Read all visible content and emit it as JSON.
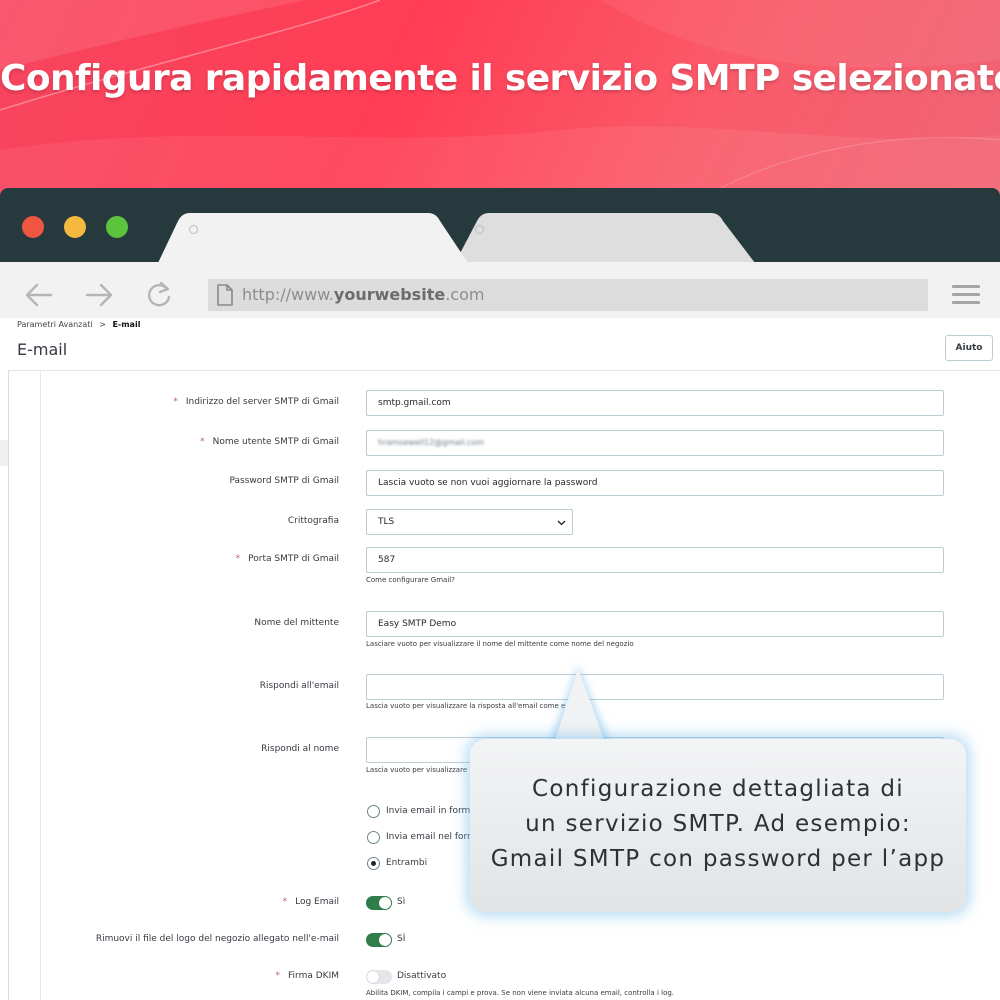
{
  "banner": {
    "title": "Configura rapidamente il servizio SMTP selezionato"
  },
  "browser": {
    "url_prefix": "http://www.",
    "url_domain": "yourwebsite",
    "url_suffix": ".com",
    "traffic_lights": [
      "#f05542",
      "#f4b93e",
      "#5bc33c"
    ],
    "icons": [
      "back-arrow-icon",
      "forward-arrow-icon",
      "reload-icon",
      "page-icon",
      "hamburger-menu-icon"
    ]
  },
  "page": {
    "breadcrumb_parent": "Parametri Avanzati",
    "breadcrumb_separator": ">",
    "breadcrumb_current": "E-mail",
    "title": "E-mail",
    "help_button": "Aiuto"
  },
  "form": {
    "smtp_server": {
      "label": "Indirizzo del server SMTP di Gmail",
      "value": "smtp.gmail.com",
      "required": "*"
    },
    "smtp_username": {
      "label": "Nome utente SMTP di Gmail",
      "value": "hramsewell12@gmail.com",
      "required": "*"
    },
    "smtp_password": {
      "label": "Password SMTP di Gmail",
      "placeholder": "Lascia vuoto se non vuoi aggiornare la password"
    },
    "encryption": {
      "label": "Crittografia",
      "value": "TLS"
    },
    "smtp_port": {
      "label": "Porta SMTP di Gmail",
      "value": "587",
      "required": "*",
      "help_link": "Come configurare Gmail?"
    },
    "sender_name": {
      "label": "Nome del mittente",
      "value": "Easy SMTP Demo",
      "help": "Lasciare vuoto per visualizzare il nome del mittente come nome del negozio"
    },
    "reply_to_email": {
      "label": "Rispondi all'email",
      "value": "",
      "help": "Lascia vuoto per visualizzare la risposta all'email come e-ma"
    },
    "reply_to_name": {
      "label": "Rispondi al nome",
      "value": "",
      "help": "Lascia vuoto per visualizzare"
    },
    "email_format": {
      "options": [
        "Invia email in forma",
        "Invia email nel form",
        "Entrambi"
      ],
      "selected": "Entrambi"
    },
    "log_email": {
      "label": "Log Email",
      "required": "*",
      "state": "Sì"
    },
    "remove_logo": {
      "label": "Rimuovi il file del logo del negozio allegato nell'e-mail",
      "state": "SÌ"
    },
    "dkim": {
      "label": "Firma DKIM",
      "required": "*",
      "state": "Disattivato",
      "help": "Abilita DKIM, compila i campi e prova. Se non viene inviata alcuna email, controlla i log."
    }
  },
  "callout": {
    "line1": "Configurazione dettagliata di",
    "line2": "un servizio SMTP. Ad esempio:",
    "line3": "Gmail SMTP con password per l’app"
  },
  "colors": {
    "banner_gradient": [
      "#f7455f",
      "#ff3d55",
      "#f06475"
    ],
    "titlebar": "#263a3e",
    "switch_on": "#2e7d4b"
  }
}
